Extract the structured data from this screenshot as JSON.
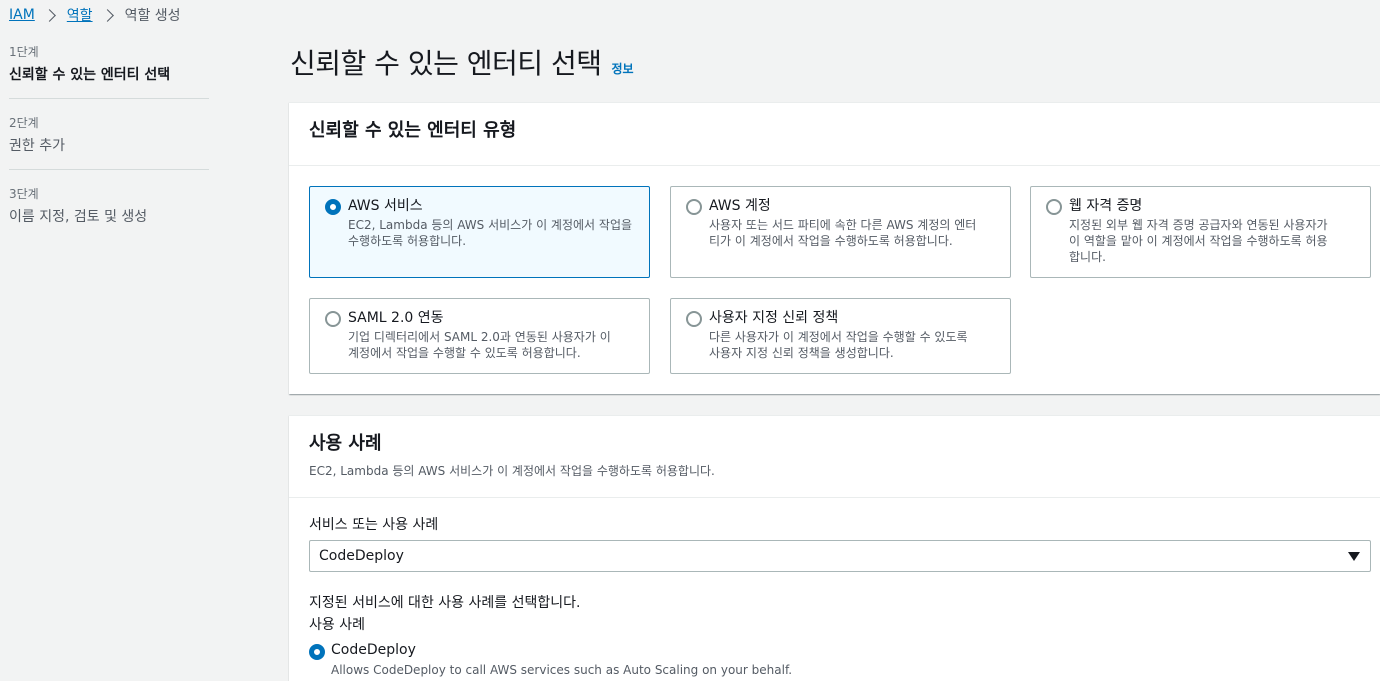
{
  "breadcrumb": {
    "items": [
      "IAM",
      "역할"
    ],
    "current": "역할 생성"
  },
  "steps": [
    {
      "num": "1단계",
      "title": "신뢰할 수 있는 엔터티 선택"
    },
    {
      "num": "2단계",
      "title": "권한 추가"
    },
    {
      "num": "3단계",
      "title": "이름 지정, 검토 및 생성"
    }
  ],
  "page": {
    "title": "신뢰할 수 있는 엔터티 선택",
    "info": "정보"
  },
  "entity_panel": {
    "title": "신뢰할 수 있는 엔터티 유형",
    "options": [
      {
        "title": "AWS 서비스",
        "desc1": "EC2, Lambda 등의 AWS 서비스가 이 계정에서 작업을",
        "desc2": "수행하도록 허용합니다.",
        "desc3": "",
        "selected": true
      },
      {
        "title": "AWS 계정",
        "desc1": "사용자 또는 서드 파티에 속한 다른 AWS 계정의 엔터",
        "desc2": "티가 이 계정에서 작업을 수행하도록 허용합니다.",
        "desc3": "",
        "selected": false
      },
      {
        "title": "웹 자격 증명",
        "desc1": "지정된 외부 웹 자격 증명 공급자와 연동된 사용자가",
        "desc2": "이 역할을 맡아 이 계정에서 작업을 수행하도록 허용",
        "desc3": "합니다.",
        "selected": false
      },
      {
        "title": "SAML 2.0 연동",
        "desc1": "기업 디렉터리에서 SAML 2.0과 연동된 사용자가 이",
        "desc2": "계정에서 작업을 수행할 수 있도록 허용합니다.",
        "desc3": "",
        "selected": false
      },
      {
        "title": "사용자 지정 신뢰 정책",
        "desc1": "다른 사용자가 이 계정에서 작업을 수행할 수 있도록",
        "desc2": "사용자 지정 신뢰 정책을 생성합니다.",
        "desc3": "",
        "selected": false
      }
    ]
  },
  "usecase_panel": {
    "title": "사용 사례",
    "description": "EC2, Lambda 등의 AWS 서비스가 이 계정에서 작업을 수행하도록 허용합니다.",
    "service_label": "서비스 또는 사용 사례",
    "service_value": "CodeDeploy",
    "choose_text": "지정된 서비스에 대한 사용 사례를 선택합니다.",
    "usecase_label": "사용 사례",
    "usecase_option_title": "CodeDeploy",
    "usecase_option_desc": "Allows CodeDeploy to call AWS services such as Auto Scaling on your behalf."
  },
  "colors": {
    "accent": "#0073bb",
    "selected_tile_bg": "#f1faff"
  }
}
